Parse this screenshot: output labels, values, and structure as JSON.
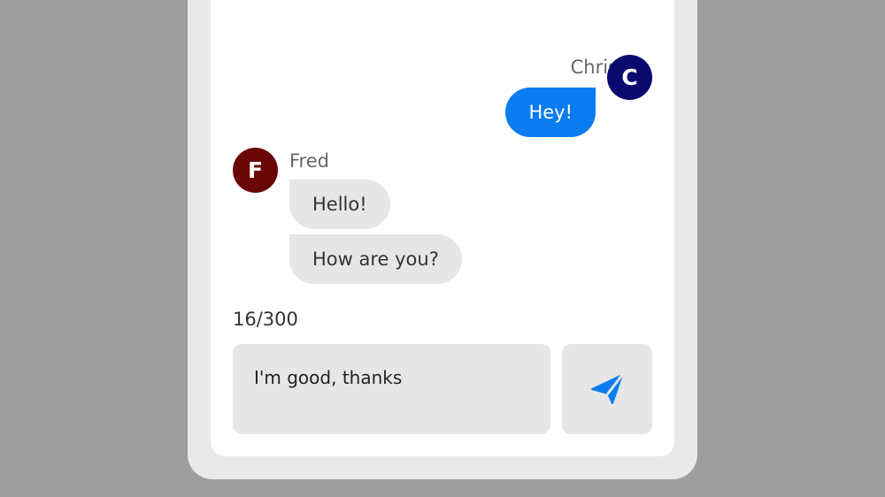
{
  "colors": {
    "backdrop": "#9e9e9e",
    "outgoing_bubble": "#0a7cf0",
    "incoming_bubble": "#e6e6e6",
    "chris_avatar": "#0a0a6e",
    "fred_avatar": "#6b0606",
    "send_icon": "#0a7cf0"
  },
  "chat": {
    "messages": [
      {
        "sender": "Chris",
        "avatar_initial": "C",
        "direction": "outgoing",
        "texts": [
          "Hey!"
        ]
      },
      {
        "sender": "Fred",
        "avatar_initial": "F",
        "direction": "incoming",
        "texts": [
          "Hello!",
          "How are you?"
        ]
      }
    ]
  },
  "composer": {
    "char_count": "16/300",
    "input_value": "I'm good, thanks",
    "send_icon": "paper-plane-icon"
  }
}
